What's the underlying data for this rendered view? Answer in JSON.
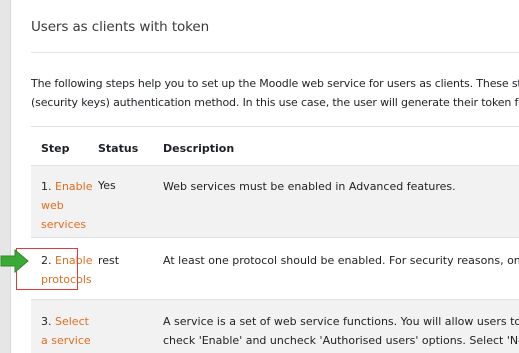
{
  "page": {
    "title": "Users as clients with token",
    "intro_line_1": "The following steps help you to set up the Moodle web service for users as clients. These ste",
    "intro_line_2": "(security keys) authentication method. In this use case, the user will generate their token fro"
  },
  "table": {
    "headers": {
      "step": "Step",
      "status": "Status",
      "description": "Description"
    },
    "rows": [
      {
        "step_num": "1.",
        "step_link": [
          "Enable",
          "web",
          "services"
        ],
        "status": "Yes",
        "desc_1": "Web services must be enabled in Advanced features.",
        "desc_2": ""
      },
      {
        "step_num": "2.",
        "step_link": [
          "Enable",
          "protocols"
        ],
        "status": "rest",
        "desc_1": "At least one protocol should be enabled. For security reasons, only",
        "desc_2": ""
      },
      {
        "step_num": "3.",
        "step_link": [
          "Select",
          "a service"
        ],
        "status": "",
        "desc_1": "A service is a set of web service functions. You will allow users to ac",
        "desc_2": "check 'Enable' and uncheck 'Authorised users' options. Select 'No r"
      }
    ]
  },
  "annotations": {
    "arrow_color": "#3aa935",
    "highlight_color": "#e0393e",
    "arrow_icon": "arrow-right-icon"
  },
  "colors": {
    "link": "#e06d20",
    "stripe": "#f2f2f2"
  }
}
